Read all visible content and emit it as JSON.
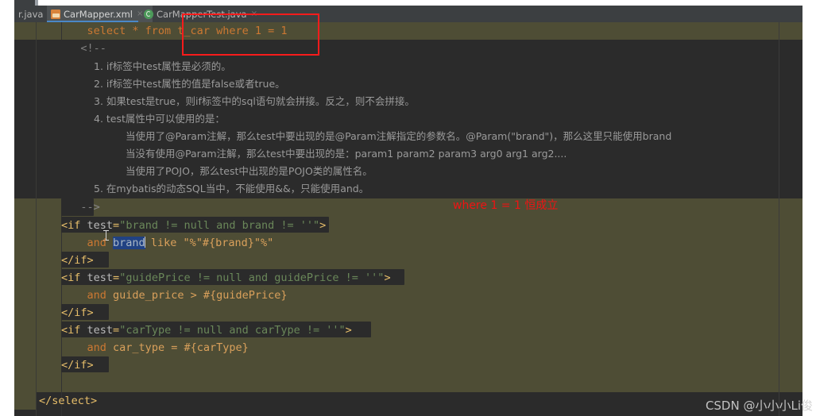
{
  "window": {
    "app": "IntelliJ IDEA",
    "file_type": "mybatis xml mapper"
  },
  "tabs": [
    {
      "label": "r.java",
      "icon": "java-file-icon",
      "close": "×",
      "selected": false,
      "partial": true
    },
    {
      "label": "CarMapper.xml",
      "icon": "xml-file-icon",
      "close": "×",
      "selected": true,
      "partial": false
    },
    {
      "label": "CarMapperTest.java",
      "icon": "java-class-icon",
      "close": "×",
      "selected": false,
      "partial": false
    }
  ],
  "code": {
    "line1": "select * from t_car where 1 = 1",
    "line2": "<!--",
    "line3": "1. if标签中test属性是必须的。",
    "line4": "2. if标签中test属性的值是false或者true。",
    "line5": "3. 如果test是true，则if标签中的sql语句就会拼接。反之，则不会拼接。",
    "line6": "4. test属性中可以使用的是：",
    "line7": "当使用了@Param注解，那么test中要出现的是@Param注解指定的参数名。@Param(\"brand\")，那么这里只能使用brand",
    "line8": "当没有使用@Param注解，那么test中要出现的是：param1 param2 param3 arg0 arg1 arg2....",
    "line9": "当使用了POJO，那么test中出现的是POJO类的属性名。",
    "line10": "5. 在mybatis的动态SQL当中，不能使用&&，只能使用and。",
    "line11": "-->",
    "if1_open_tag": "<if",
    "if1_attr": "test",
    "if1_eq": "=",
    "if1_value": "\"brand != null and brand != ''\"",
    "if1_close": ">",
    "if1_body_and": "and",
    "if1_body_sel": "brand",
    "if1_body_rest": "like \"%\"#{brand}\"%\"",
    "if1_end": "</if>",
    "if2_open_tag": "<if",
    "if2_attr": "test",
    "if2_eq": "=",
    "if2_value": "\"guidePrice != null and guidePrice != ''\"",
    "if2_close": ">",
    "if2_body_and": "and",
    "if2_body_rest": "guide_price > #{guidePrice}",
    "if2_end": "</if>",
    "if3_open_tag": "<if",
    "if3_attr": "test",
    "if3_eq": "=",
    "if3_value": "\"carType != null and carType != ''\"",
    "if3_close": ">",
    "if3_body_and": "and",
    "if3_body_rest": "car_type = #{carType}",
    "if3_end": "</if>",
    "select_end": "</select>"
  },
  "annotations": {
    "red_note": "where 1 = 1 恒成立",
    "red_note_color": "#f01313",
    "red_box_color": "#f81b1b"
  },
  "watermark": {
    "text": "CSDN @小小小Li俊"
  },
  "colors": {
    "editor_bg": "#2b2b2b",
    "band_bg": "#4e4d35",
    "tabbar_bg": "#3c3f41",
    "tab_selected_bg": "#4e5254",
    "tab_underline": "#4a88c7",
    "selection_bg": "#214283",
    "keyword": "#cc7832",
    "tag": "#e8bf6a",
    "string": "#6a8759",
    "number": "#6897bb",
    "plain": "#a9b7c6",
    "comment": "#808080"
  }
}
